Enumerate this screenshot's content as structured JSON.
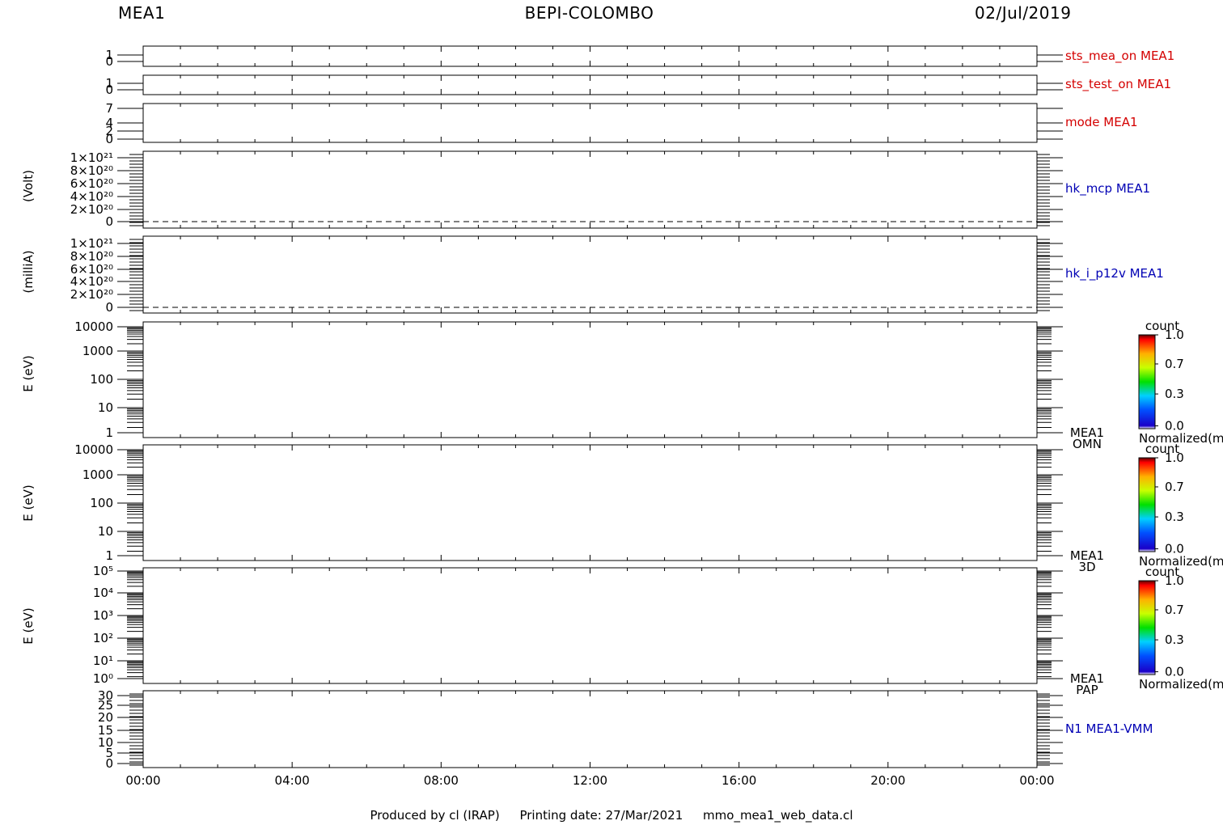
{
  "header": {
    "instrument": "MEA1",
    "mission": "BEPI-COLOMBO",
    "date": "02/Jul/2019"
  },
  "footer": {
    "produced_by": "Produced by cl (IRAP)",
    "printing_date": "Printing date: 27/Mar/2021",
    "file": "mmo_mea1_web_data.cl"
  },
  "x_axis": {
    "tick_labels": [
      "00:00",
      "04:00",
      "08:00",
      "12:00",
      "16:00",
      "20:00",
      "00:00"
    ]
  },
  "panels": [
    {
      "label": "sts_mea_on MEA1",
      "label_color": "#d40000",
      "ylabel": "",
      "ytick_labels": [
        "1",
        "0"
      ]
    },
    {
      "label": "sts_test_on MEA1",
      "label_color": "#d40000",
      "ylabel": "",
      "ytick_labels": [
        "1",
        "0"
      ]
    },
    {
      "label": "mode MEA1",
      "label_color": "#d40000",
      "ylabel": "",
      "ytick_labels": [
        "7",
        "4",
        "2",
        "0"
      ]
    },
    {
      "label": "hk_mcp MEA1",
      "label_color": "#0000b4",
      "ylabel": "(Volt)",
      "ytick_labels": [
        "1×10²¹",
        "8×10²⁰",
        "6×10²⁰",
        "4×10²⁰",
        "2×10²⁰",
        "0"
      ]
    },
    {
      "label": "hk_i_p12v MEA1",
      "label_color": "#0000b4",
      "ylabel": "(milliA)",
      "ytick_labels": [
        "1×10²¹",
        "8×10²⁰",
        "6×10²⁰",
        "4×10²⁰",
        "2×10²⁰",
        "0"
      ]
    },
    {
      "label": "MEA1",
      "label2": "OMN",
      "label_color": "#000000",
      "ylabel": "E (eV)",
      "ytick_labels": [
        "10000",
        "1000",
        "100",
        "10",
        "1"
      ]
    },
    {
      "label": "MEA1",
      "label2": "3D",
      "label_color": "#000000",
      "ylabel": "E (eV)",
      "ytick_labels": [
        "10000",
        "1000",
        "100",
        "10",
        "1"
      ]
    },
    {
      "label": "MEA1",
      "label2": "PAP",
      "label_color": "#000000",
      "ylabel": "E (eV)",
      "ytick_labels": [
        "10⁵",
        "10⁴",
        "10³",
        "10²",
        "10¹",
        "10⁰"
      ]
    },
    {
      "label": "N1 MEA1-VMM",
      "label_color": "#0000b4",
      "ylabel": "",
      "ytick_labels": [
        "30",
        "25",
        "20",
        "15",
        "10",
        "5",
        "0"
      ]
    }
  ],
  "colorbars": [
    {
      "title": "count",
      "tick_labels": [
        "1.0",
        "0.7",
        "0.3",
        "0.0"
      ],
      "caption": "Normalized(m"
    },
    {
      "title": "count",
      "tick_labels": [
        "1.0",
        "0.7",
        "0.3",
        "0.0"
      ],
      "caption": "Normalized(m"
    },
    {
      "title": "count",
      "tick_labels": [
        "1.0",
        "0.7",
        "0.3",
        "0.0"
      ],
      "caption": "Normalized(m"
    }
  ],
  "chart_data": [
    {
      "type": "line",
      "title": "sts_mea_on MEA1",
      "x": [
        "00:00",
        "04:00",
        "08:00",
        "12:00",
        "16:00",
        "20:00",
        "00:00"
      ],
      "ylim": [
        -0.6,
        1.6
      ],
      "yticks": [
        1,
        0
      ],
      "series": []
    },
    {
      "type": "line",
      "title": "sts_test_on MEA1",
      "ylim": [
        -0.6,
        1.6
      ],
      "yticks": [
        1,
        0
      ],
      "series": []
    },
    {
      "type": "line",
      "title": "mode MEA1",
      "ylim": [
        -0.3,
        7.5
      ],
      "yticks": [
        7,
        4,
        2,
        0
      ],
      "series": []
    },
    {
      "type": "line",
      "title": "hk_mcp MEA1",
      "ylabel": "(Volt)",
      "ylim": [
        -1e+20,
        1.1e+21
      ],
      "yticks": [
        1e+21,
        8e+20,
        6e+20,
        4e+20,
        2e+20,
        0
      ],
      "reference_line": 0,
      "series": []
    },
    {
      "type": "line",
      "title": "hk_i_p12v MEA1",
      "ylabel": "(milliA)",
      "ylim": [
        -1e+20,
        1.1e+21
      ],
      "yticks": [
        1e+21,
        8e+20,
        6e+20,
        4e+20,
        2e+20,
        0
      ],
      "reference_line": 0,
      "series": []
    },
    {
      "type": "heatmap",
      "title": "MEA1 OMN",
      "ylabel": "E (eV)",
      "yscale": "log",
      "ylim": [
        1,
        12000
      ],
      "yticks": [
        10000,
        1000,
        100,
        10,
        1
      ],
      "colorbar": "count",
      "values": []
    },
    {
      "type": "heatmap",
      "title": "MEA1 3D",
      "ylabel": "E (eV)",
      "yscale": "log",
      "ylim": [
        1,
        12000
      ],
      "yticks": [
        10000,
        1000,
        100,
        10,
        1
      ],
      "colorbar": "count",
      "values": []
    },
    {
      "type": "heatmap",
      "title": "MEA1 PAP",
      "ylabel": "E (eV)",
      "yscale": "log",
      "ylim": [
        1,
        100000
      ],
      "yticks": [
        100000,
        10000,
        1000,
        100,
        10,
        1
      ],
      "colorbar": "count",
      "values": []
    },
    {
      "type": "line",
      "title": "N1 MEA1-VMM",
      "ylim": [
        -0.5,
        31
      ],
      "yticks": [
        30,
        25,
        20,
        15,
        10,
        5,
        0
      ],
      "series": []
    }
  ]
}
